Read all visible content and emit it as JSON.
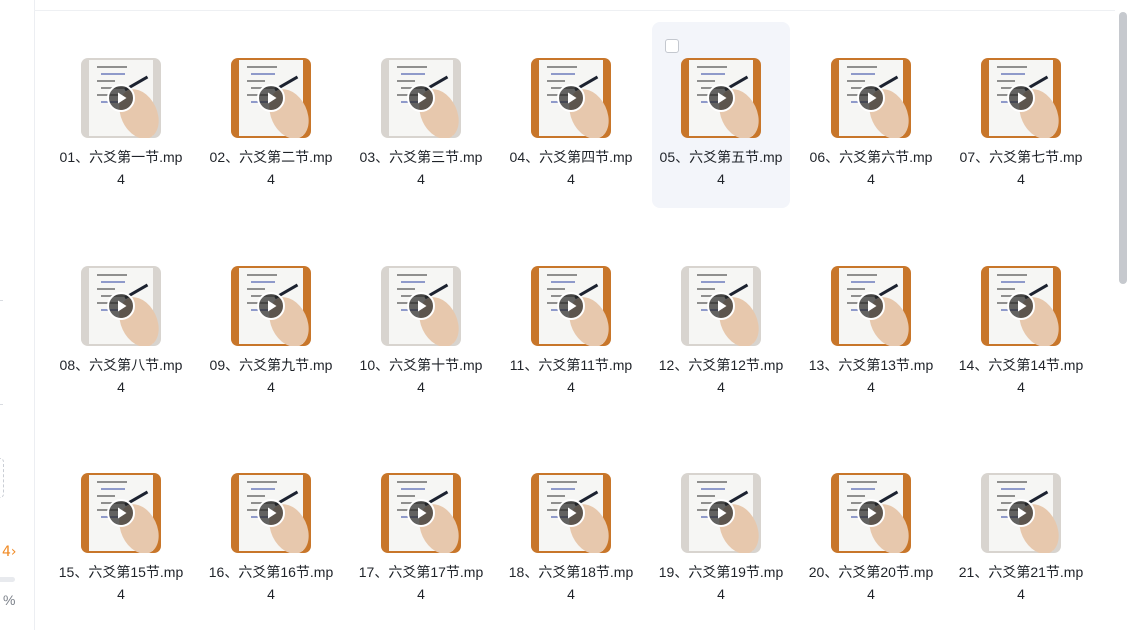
{
  "sidebar": {
    "percent_symbol": "%",
    "arrow_glyph": "4›"
  },
  "files": [
    {
      "name": "01、六爻第一节.mp4",
      "tone": "light"
    },
    {
      "name": "02、六爻第二节.mp4",
      "tone": "orange"
    },
    {
      "name": "03、六爻第三节.mp4",
      "tone": "light"
    },
    {
      "name": "04、六爻第四节.mp4",
      "tone": "orange"
    },
    {
      "name": "05、六爻第五节.mp4",
      "tone": "orange",
      "selected": true
    },
    {
      "name": "06、六爻第六节.mp4",
      "tone": "orange"
    },
    {
      "name": "07、六爻第七节.mp4",
      "tone": "orange"
    },
    {
      "name": "08、六爻第八节.mp4",
      "tone": "light"
    },
    {
      "name": "09、六爻第九节.mp4",
      "tone": "orange"
    },
    {
      "name": "10、六爻第十节.mp4",
      "tone": "light"
    },
    {
      "name": "11、六爻第11节.mp4",
      "tone": "orange"
    },
    {
      "name": "12、六爻第12节.mp4",
      "tone": "light"
    },
    {
      "name": "13、六爻第13节.mp4",
      "tone": "orange"
    },
    {
      "name": "14、六爻第14节.mp4",
      "tone": "orange"
    },
    {
      "name": "15、六爻第15节.mp4",
      "tone": "orange"
    },
    {
      "name": "16、六爻第16节.mp4",
      "tone": "orange"
    },
    {
      "name": "17、六爻第17节.mp4",
      "tone": "orange"
    },
    {
      "name": "18、六爻第18节.mp4",
      "tone": "orange"
    },
    {
      "name": "19、六爻第19节.mp4",
      "tone": "light"
    },
    {
      "name": "20、六爻第20节.mp4",
      "tone": "orange"
    },
    {
      "name": "21、六爻第21节.mp4",
      "tone": "light"
    }
  ],
  "colors": {
    "accent_orange": "#c8762a",
    "selected_bg": "#f3f5fa",
    "scrollbar": "#c6c9ce"
  },
  "icons": {
    "play": "play-icon",
    "checkbox": "checkbox-icon"
  }
}
